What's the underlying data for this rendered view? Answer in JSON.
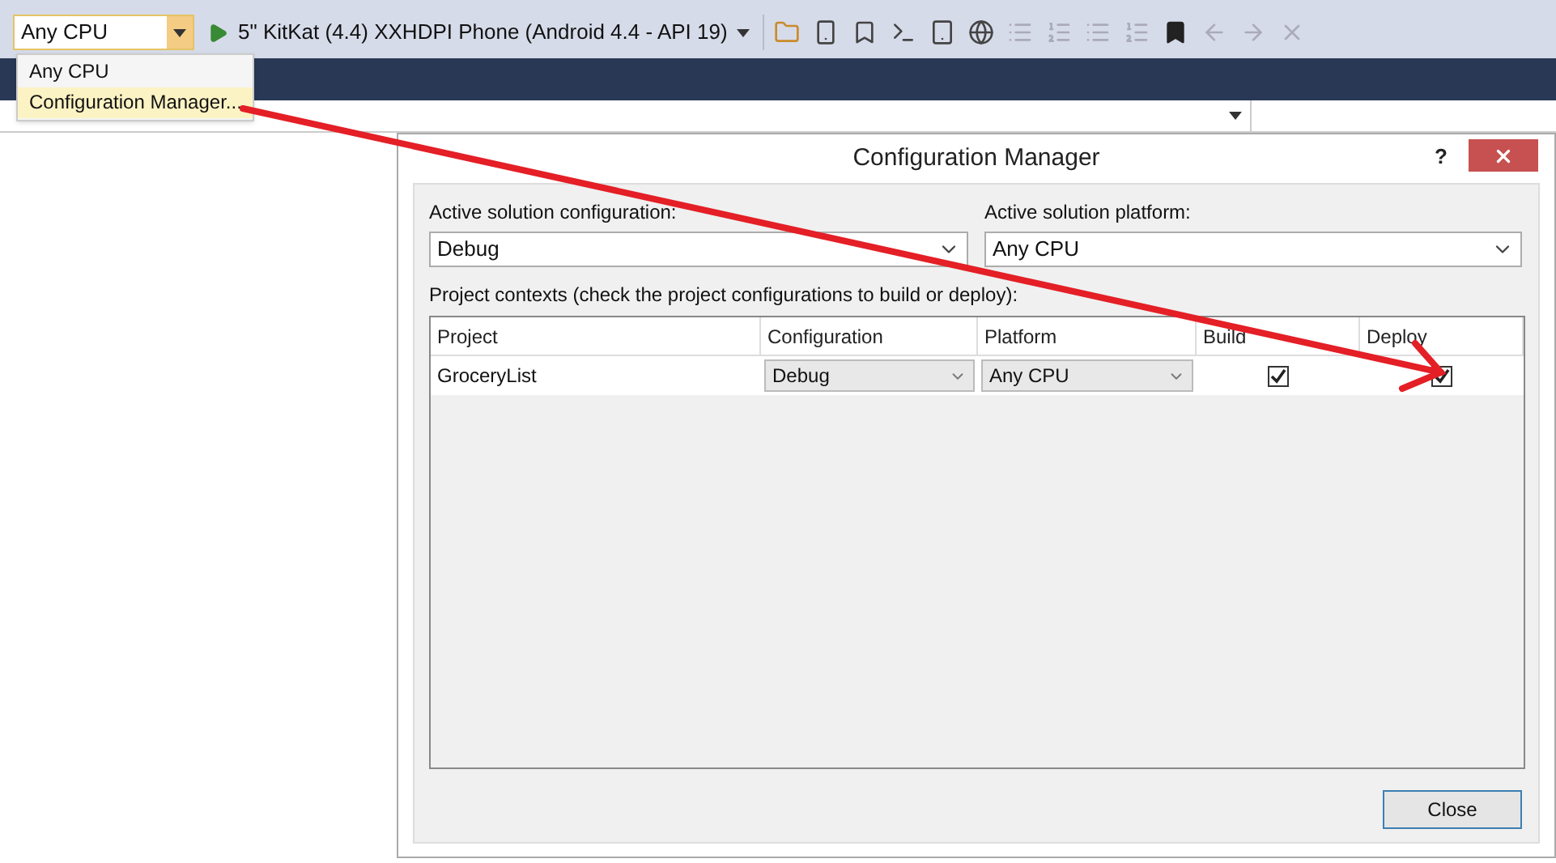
{
  "toolbar": {
    "platform_combo": {
      "value": "Any CPU"
    },
    "run_target": "5\" KitKat (4.4) XXHDPI Phone (Android 4.4 - API 19)"
  },
  "platform_menu": {
    "items": [
      {
        "label": "Any CPU",
        "selected": false
      },
      {
        "label": "Configuration Manager...",
        "selected": true
      }
    ]
  },
  "dialog": {
    "title": "Configuration Manager",
    "help": "?",
    "active_configuration": {
      "label": "Active solution configuration:",
      "value": "Debug"
    },
    "active_platform": {
      "label": "Active solution platform:",
      "value": "Any CPU"
    },
    "contexts_label": "Project contexts (check the project configurations to build or deploy):",
    "table": {
      "columns": [
        "Project",
        "Configuration",
        "Platform",
        "Build",
        "Deploy"
      ],
      "rows": [
        {
          "project": "GroceryList",
          "configuration": "Debug",
          "platform": "Any CPU",
          "build": true,
          "deploy": true
        }
      ]
    },
    "close_button": "Close"
  }
}
